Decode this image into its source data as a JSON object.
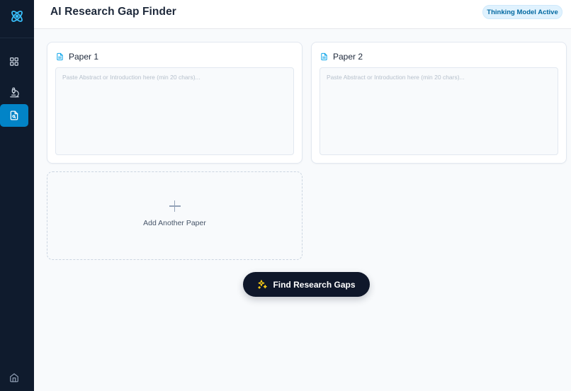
{
  "app": {
    "title": "AI Research Gap Finder",
    "status_badge": "Thinking Model Active"
  },
  "sidebar": {
    "logo_icon": "atom-icon",
    "items": [
      {
        "icon": "grid-icon",
        "active": false
      },
      {
        "icon": "microscope-icon",
        "active": false
      },
      {
        "icon": "document-search-icon",
        "active": true
      }
    ],
    "footer_icon": "home-icon"
  },
  "papers": [
    {
      "title": "Paper 1",
      "value": "",
      "placeholder": "Paste Abstract or Introduction here (min 20 chars)..."
    },
    {
      "title": "Paper 2",
      "value": "",
      "placeholder": "Paste Abstract or Introduction here (min 20 chars)..."
    }
  ],
  "add_paper": {
    "label": "Add Another Paper"
  },
  "actions": {
    "find_label": "Find Research Gaps"
  },
  "colors": {
    "sidebar_bg": "#0f1b2d",
    "accent": "#0284c7",
    "logo": "#38bdf8",
    "button_bg": "#0f172a",
    "sparkle": "#facc15"
  }
}
